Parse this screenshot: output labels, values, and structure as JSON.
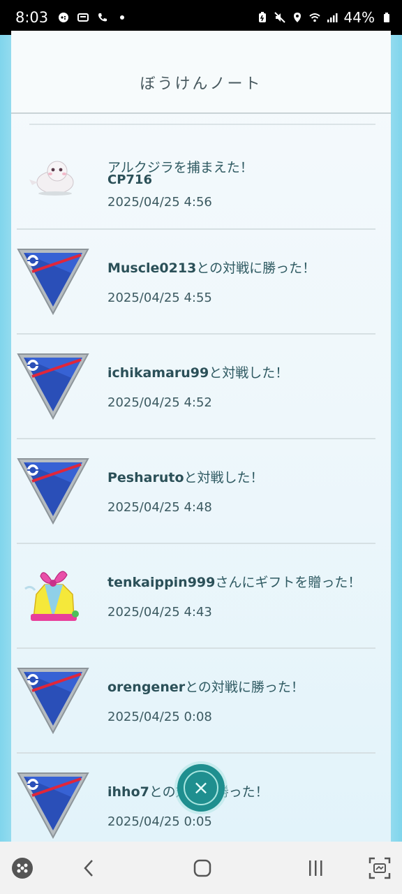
{
  "status_bar": {
    "time": "8:03",
    "battery": "44%",
    "icons": [
      "game-icon",
      "link-icon",
      "phone-call-icon",
      "dot-icon",
      "battery-saver-icon",
      "mute-icon",
      "location-icon",
      "wifi-icon",
      "signal-icon",
      "battery-icon"
    ]
  },
  "header": {
    "title": "ぼうけんノート"
  },
  "entries": [
    {
      "icon": "pokemon-icon",
      "text": "アルクジラを捕まえた！",
      "cp": "CP716",
      "date": "2025/04/25 4:56"
    },
    {
      "icon": "great-league-icon",
      "name": "Muscle0213",
      "suffix": "との対戦に勝った！",
      "date": "2025/04/25 4:55"
    },
    {
      "icon": "great-league-icon",
      "name": "ichikamaru99",
      "suffix": "と対戦した！",
      "date": "2025/04/25 4:52"
    },
    {
      "icon": "great-league-icon",
      "name": "Pesharuto",
      "suffix": "と対戦した！",
      "date": "2025/04/25 4:48"
    },
    {
      "icon": "gift-icon",
      "name": "tenkaippin999",
      "suffix": "さんにギフトを贈った！",
      "date": "2025/04/25 4:43"
    },
    {
      "icon": "great-league-icon",
      "name": "orengener",
      "suffix": "との対戦に勝った！",
      "date": "2025/04/25 0:08"
    },
    {
      "icon": "great-league-icon",
      "name": "ihho7",
      "suffix": "との対戦に勝った！",
      "date": "2025/04/25 0:05"
    }
  ],
  "close_button": {
    "icon": "close-icon",
    "glyph": "×"
  },
  "navbar": {
    "icons": [
      "apps-icon",
      "back-icon",
      "home-icon",
      "recents-icon",
      "screenshot-icon"
    ]
  }
}
